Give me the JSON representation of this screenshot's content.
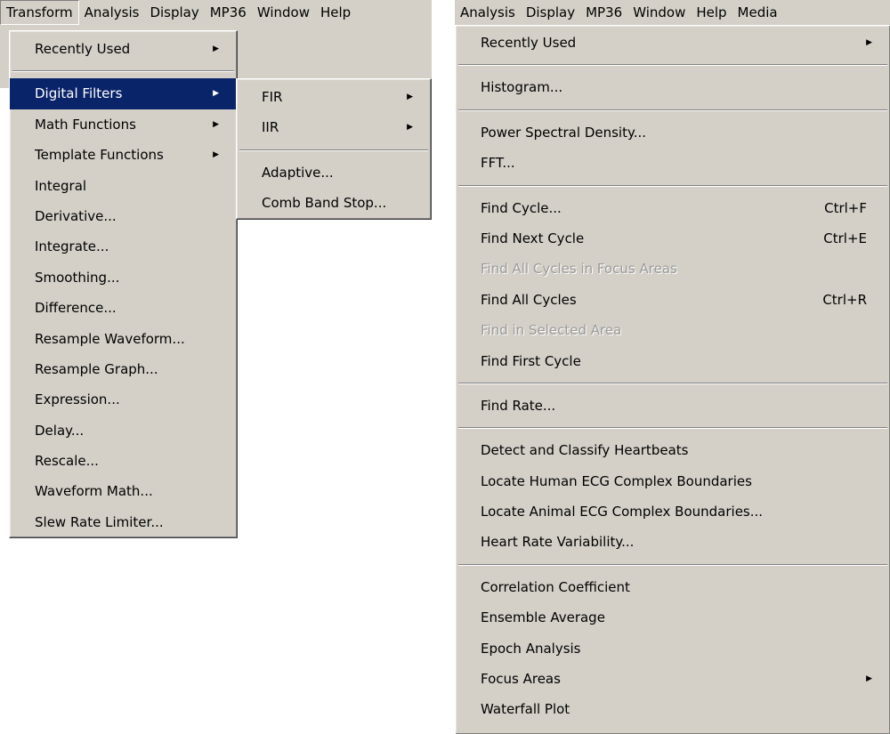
{
  "left": {
    "menubar": [
      "Transform",
      "Analysis",
      "Display",
      "MP36",
      "Window",
      "Help"
    ],
    "transform_menu": [
      {
        "label": "Recently Used",
        "submenu": true
      },
      {
        "sep": true
      },
      {
        "label": "Digital Filters",
        "submenu": true,
        "highlight": true
      },
      {
        "label": "Math Functions",
        "submenu": true
      },
      {
        "label": "Template Functions",
        "submenu": true
      },
      {
        "label": "Integral"
      },
      {
        "label": "Derivative..."
      },
      {
        "label": "Integrate..."
      },
      {
        "label": "Smoothing..."
      },
      {
        "label": "Difference..."
      },
      {
        "label": "Resample Waveform..."
      },
      {
        "label": "Resample Graph..."
      },
      {
        "label": "Expression..."
      },
      {
        "label": "Delay..."
      },
      {
        "label": "Rescale..."
      },
      {
        "label": "Waveform Math..."
      },
      {
        "label": "Slew Rate Limiter..."
      }
    ],
    "filters_submenu": [
      {
        "label": "FIR",
        "submenu": true
      },
      {
        "label": "IIR",
        "submenu": true
      },
      {
        "sep": true
      },
      {
        "label": "Adaptive..."
      },
      {
        "label": "Comb Band Stop..."
      }
    ]
  },
  "right": {
    "menubar": [
      "Analysis",
      "Display",
      "MP36",
      "Window",
      "Help",
      "Media"
    ],
    "analysis_menu": [
      {
        "label": "Recently Used",
        "submenu": true
      },
      {
        "sep": true
      },
      {
        "label": "Histogram..."
      },
      {
        "sep": true
      },
      {
        "label": "Power Spectral Density..."
      },
      {
        "label": "FFT..."
      },
      {
        "sep": true
      },
      {
        "label": "Find Cycle...",
        "shortcut": "Ctrl+F"
      },
      {
        "label": "Find Next Cycle",
        "shortcut": "Ctrl+E"
      },
      {
        "label": "Find All Cycles in Focus Areas",
        "disabled": true
      },
      {
        "label": "Find All Cycles",
        "shortcut": "Ctrl+R"
      },
      {
        "label": "Find in Selected Area",
        "disabled": true
      },
      {
        "label": "Find First Cycle"
      },
      {
        "sep": true
      },
      {
        "label": "Find Rate..."
      },
      {
        "sep": true
      },
      {
        "label": "Detect and Classify Heartbeats"
      },
      {
        "label": "Locate Human ECG Complex Boundaries"
      },
      {
        "label": "Locate Animal ECG Complex Boundaries..."
      },
      {
        "label": "Heart Rate Variability..."
      },
      {
        "sep": true
      },
      {
        "label": "Correlation Coefficient"
      },
      {
        "label": "Ensemble Average"
      },
      {
        "label": "Epoch Analysis"
      },
      {
        "label": "Focus Areas",
        "submenu": true
      },
      {
        "label": "Waterfall Plot"
      }
    ]
  },
  "icons": {
    "submenu_arrow": "▶"
  }
}
